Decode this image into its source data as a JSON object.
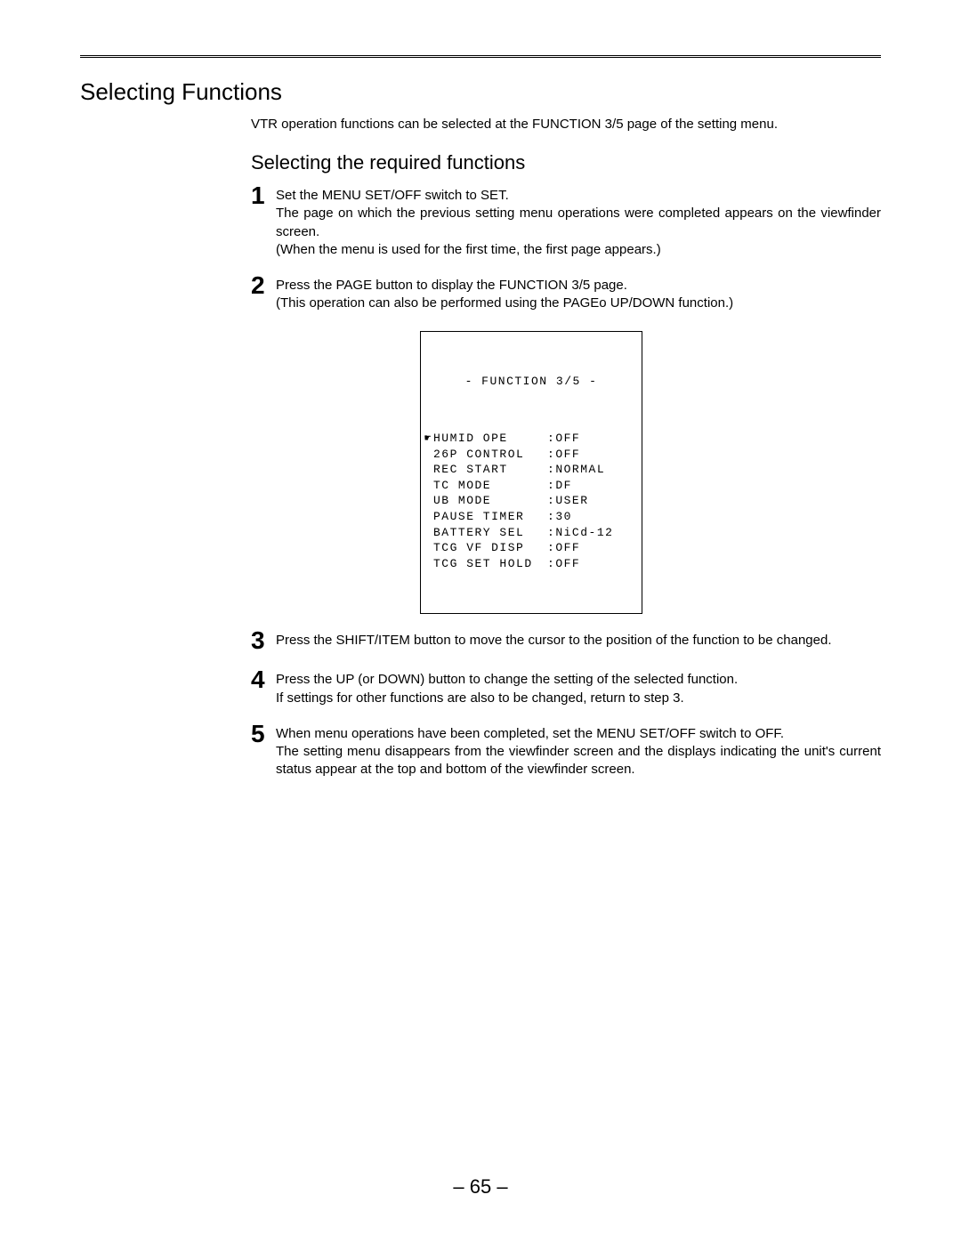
{
  "title": "Selecting Functions",
  "intro": "VTR operation functions can be selected at the FUNCTION 3/5 page of the setting menu.",
  "subheading": "Selecting the required functions",
  "steps": [
    {
      "num": "1",
      "lines": [
        "Set the MENU SET/OFF switch to SET.",
        "The page on which the previous setting menu operations were completed appears on the viewfinder screen.",
        "(When the menu is used for the first time, the first page appears.)"
      ]
    },
    {
      "num": "2",
      "lines": [
        "Press the PAGE button to display the FUNCTION 3/5 page.",
        "(This operation can also be performed using the PAGEo UP/DOWN function.)"
      ]
    },
    {
      "num": "3",
      "lines": [
        "Press the SHIFT/ITEM button to move the cursor to the position of the function to be changed."
      ]
    },
    {
      "num": "4",
      "lines": [
        "Press the UP (or DOWN) button to change the setting of the selected function.",
        "If settings for other functions are also to be changed, return to step 3."
      ]
    },
    {
      "num": "5",
      "lines": [
        "When menu operations have been completed, set the MENU SET/OFF switch to OFF.",
        "The setting menu disappears from the viewfinder screen and the displays indicating the unit's current status appear at the top and bottom of the viewfinder screen."
      ]
    }
  ],
  "menu": {
    "header": "- FUNCTION 3/5 -",
    "cursor": "☛",
    "rows": [
      {
        "label": "HUMID OPE",
        "value": "OFF",
        "cursor": true
      },
      {
        "label": "26P CONTROL",
        "value": "OFF",
        "cursor": false
      },
      {
        "label": "REC START",
        "value": "NORMAL",
        "cursor": false
      },
      {
        "label": "TC MODE",
        "value": "DF",
        "cursor": false
      },
      {
        "label": "UB MODE",
        "value": "USER",
        "cursor": false
      },
      {
        "label": "PAUSE TIMER",
        "value": "30",
        "cursor": false
      },
      {
        "label": "BATTERY SEL",
        "value": "NiCd-12",
        "cursor": false
      },
      {
        "label": "TCG VF DISP",
        "value": "OFF",
        "cursor": false
      },
      {
        "label": "TCG SET HOLD",
        "value": "OFF",
        "cursor": false
      }
    ]
  },
  "page_number": "– 65 –"
}
